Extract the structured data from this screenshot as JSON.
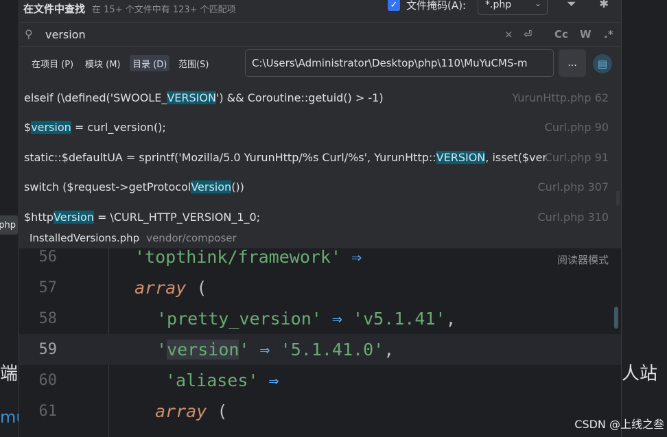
{
  "background": {
    "left_tab": "php",
    "left_text_1": "端",
    "left_text_2": "mu",
    "right_text": "人站​"
  },
  "dialog": {
    "title": "在文件中查找",
    "subtitle": "在 15+ 个文件中有 123+ 个匹配项",
    "file_mask_label": "文件掩码(A):",
    "file_mask_checked": true,
    "file_mask_value": "*.php",
    "filter_icon": "filter-icon",
    "pin_icon": "pin-icon"
  },
  "search": {
    "query": "version",
    "icons": {
      "clear": "×",
      "newline": "⏎",
      "match_case": "Cc",
      "whole_word": "W",
      "regex": ".*"
    }
  },
  "scope": {
    "tabs": [
      {
        "label": "在项目 (P)",
        "active": false
      },
      {
        "label": "模块 (M)",
        "active": false
      },
      {
        "label": "目录 (D)",
        "active": true
      },
      {
        "label": "范围(S)",
        "active": false
      }
    ],
    "directory": "C:\\Users\\Administrator\\Desktop\\php\\110\\MuYuCMS-m",
    "browse_label": "...",
    "accent": "#3574f0",
    "highlight": "#0f5b6e"
  },
  "results": [
    {
      "before": "elseif (\\defined('SWOOLE_",
      "match": "VERSION",
      "after": "') && Coroutine::getuid() > -1)",
      "file": "YurunHttp.php 62"
    },
    {
      "before": "$",
      "match": "version",
      "after": " = curl_version();",
      "file": "Curl.php 90"
    },
    {
      "before": "static::$defaultUA = sprintf('Mozilla/5.0 YurunHttp/%s Curl/%s', YurunHttp::",
      "match": "VERSION",
      "after": ", isset($versi",
      "file": "Curl.php 91"
    },
    {
      "before": "switch ($request->getProtocol",
      "match": "Version",
      "after": "())",
      "file": "Curl.php 307"
    },
    {
      "before": "$http",
      "match": "Version",
      "after": " = \\CURL_HTTP_VERSION_1_0;",
      "file": "Curl.php 310"
    }
  ],
  "preview": {
    "file_name": "InstalledVersions.php",
    "file_path": "vendor/composer",
    "reader_mode": "阅读器模式",
    "lines": [
      {
        "num": "56",
        "string": "'topthink/framework'",
        "arrow": "⇒",
        "rest": ""
      },
      {
        "num": "57",
        "keyword": "array",
        "paren": "("
      },
      {
        "num": "58",
        "string": "'pretty_version'",
        "arrow": "⇒",
        "value": "'v5.1.41'",
        "comma": ","
      },
      {
        "num": "59",
        "string_pre": "'",
        "string_hl": "version",
        "string_post": "'",
        "arrow": "⇒",
        "value": "'5.1.41.0'",
        "comma": ","
      },
      {
        "num": "60",
        "string": "'aliases'",
        "arrow": "⇒"
      },
      {
        "num": "61",
        "keyword": "array",
        "paren": "("
      }
    ]
  },
  "watermark": "CSDN @上线之叁"
}
